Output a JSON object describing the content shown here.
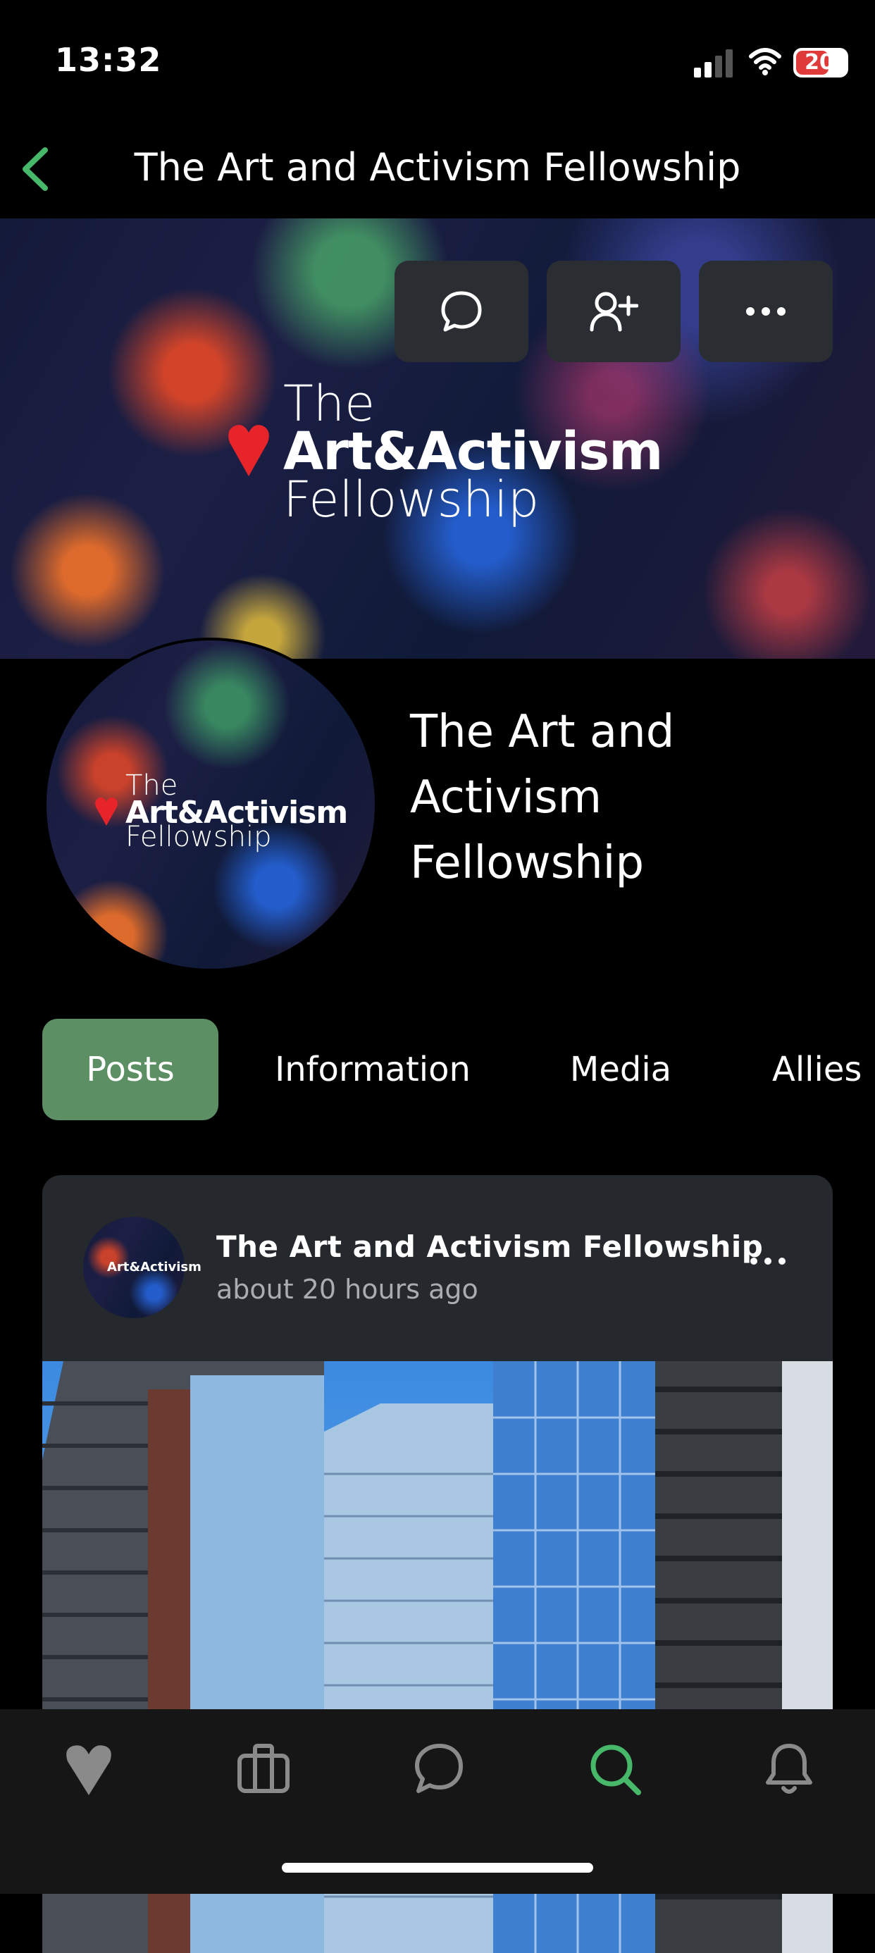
{
  "status_bar": {
    "time": "13:32",
    "battery": "20"
  },
  "header": {
    "title": "The Art and Activism Fellowship"
  },
  "banner": {
    "logo_line1": "The",
    "logo_line2": "Art&Activism",
    "logo_line3": "Fellowship",
    "actions": [
      "chat-icon",
      "add-ally-icon",
      "more-icon"
    ]
  },
  "profile": {
    "name": "The Art and Activism Fellowship",
    "avatar_logo_line1": "The",
    "avatar_logo_line2": "Art&Activism",
    "avatar_logo_line3": "Fellowship"
  },
  "tabs": [
    {
      "label": "Posts",
      "active": true
    },
    {
      "label": "Information",
      "active": false
    },
    {
      "label": "Media",
      "active": false
    },
    {
      "label": "Allies",
      "active": false
    }
  ],
  "post": {
    "author": "The Art and Activism Fellowship",
    "time": "about 20 hours ago",
    "avatar_logo_text": "Art&Activism"
  },
  "bottom_nav": {
    "items": [
      "heart-icon",
      "briefcase-icon",
      "chat-icon",
      "search-icon",
      "bell-icon"
    ],
    "active": "search-icon"
  },
  "colors": {
    "accent": "#5c8f63",
    "accent_icon": "#47b86a",
    "card": "#25282c",
    "heart": "#e8242b"
  }
}
